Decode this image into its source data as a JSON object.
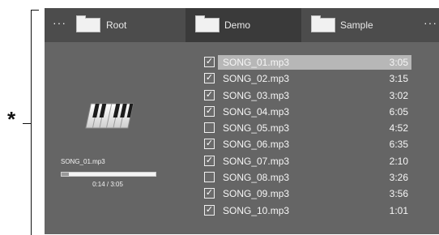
{
  "callout": {
    "marker": "*"
  },
  "tabs": [
    {
      "label": "Root",
      "active": false
    },
    {
      "label": "Demo",
      "active": true
    },
    {
      "label": "Sample",
      "active": false
    }
  ],
  "overflow": {
    "left": "···",
    "right": "···"
  },
  "now_playing": {
    "title": "SONG_01.mp3",
    "time": "0:14 / 3:05",
    "progress": 0.0757,
    "icon": "piano-icon"
  },
  "songs": [
    {
      "name": "SONG_01.mp3",
      "duration": "3:05",
      "checked": true,
      "selected": true
    },
    {
      "name": "SONG_02.mp3",
      "duration": "3:15",
      "checked": true,
      "selected": false
    },
    {
      "name": "SONG_03.mp3",
      "duration": "3:02",
      "checked": true,
      "selected": false
    },
    {
      "name": "SONG_04.mp3",
      "duration": "6:05",
      "checked": true,
      "selected": false
    },
    {
      "name": "SONG_05.mp3",
      "duration": "4:52",
      "checked": false,
      "selected": false
    },
    {
      "name": "SONG_06.mp3",
      "duration": "6:35",
      "checked": true,
      "selected": false
    },
    {
      "name": "SONG_07.mp3",
      "duration": "2:10",
      "checked": true,
      "selected": false
    },
    {
      "name": "SONG_08.mp3",
      "duration": "3:26",
      "checked": false,
      "selected": false
    },
    {
      "name": "SONG_09.mp3",
      "duration": "3:56",
      "checked": true,
      "selected": false
    },
    {
      "name": "SONG_10.mp3",
      "duration": "1:01",
      "checked": true,
      "selected": false
    }
  ],
  "colors": {
    "background": "#656565",
    "tabbar": "#4c4c4c",
    "active_tab": "#3a3a3a",
    "selection": "#b7b7b7"
  }
}
